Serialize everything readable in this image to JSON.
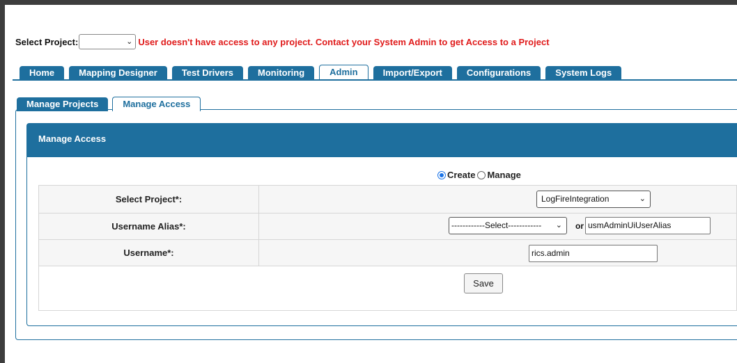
{
  "project_bar": {
    "label": "Select Project:",
    "selected": "",
    "message": "User doesn't have access to any project. Contact your System Admin to get Access to a Project"
  },
  "main_tabs": [
    {
      "label": "Home"
    },
    {
      "label": "Mapping Designer"
    },
    {
      "label": "Test Drivers"
    },
    {
      "label": "Monitoring"
    },
    {
      "label": "Admin",
      "active": true
    },
    {
      "label": "Import/Export"
    },
    {
      "label": "Configurations"
    },
    {
      "label": "System Logs"
    }
  ],
  "sub_tabs": [
    {
      "label": "Manage Projects"
    },
    {
      "label": "Manage Access",
      "active": true
    }
  ],
  "panel": {
    "header": "Manage Access",
    "mode": {
      "create_label": "Create",
      "manage_label": "Manage",
      "selected": "Create"
    },
    "form": {
      "project_label": "Select Project*:",
      "project_value": "LogFireIntegration",
      "alias_label": "Username Alias*:",
      "alias_select_value": "------------Select------------",
      "or_label": "or",
      "alias_input_value": "usmAdminUiUserAlias",
      "username_label": "Username*:",
      "username_value": "rics.admin",
      "save_label": "Save"
    }
  },
  "icons": {
    "dropdown": "chevron-down-icon",
    "radio": "radio-button-icon"
  },
  "colors": {
    "accent": "#1e6f9e",
    "error": "#e01b1b",
    "radio_checked": "#1a73e8"
  }
}
